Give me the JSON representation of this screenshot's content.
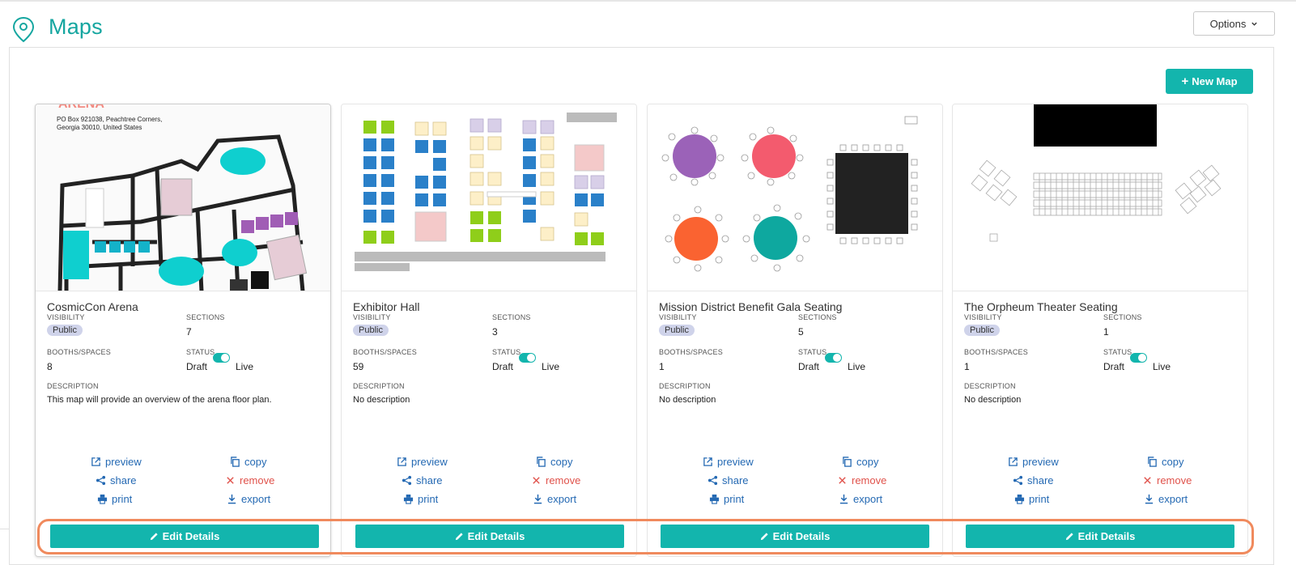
{
  "page": {
    "title": "Maps",
    "title_icon": "map-pin-icon",
    "options_label": "Options",
    "new_map_label": "New Map",
    "accent_color": "#13b5ad",
    "highlight_color": "#f08a5d"
  },
  "labels": {
    "visibility": "VISIBILITY",
    "sections": "SECTIONS",
    "booths": "BOOTHS/SPACES",
    "status": "STATUS",
    "description": "DESCRIPTION",
    "draft": "Draft",
    "live": "Live",
    "preview": "preview",
    "copy": "copy",
    "share": "share",
    "remove": "remove",
    "print": "print",
    "export": "export",
    "edit_details": "Edit Details"
  },
  "cards": [
    {
      "name": "CosmicCon Arena",
      "visibility": "Public",
      "sections": "7",
      "booths": "8",
      "status_live": true,
      "description": "This map will provide an overview of the arena floor plan.",
      "thumb_text": [
        "PO Box 921038, Peachtree Corners,",
        "Georgia 30010, United States"
      ],
      "thumb_heading": "ARENA"
    },
    {
      "name": "Exhibitor Hall",
      "visibility": "Public",
      "sections": "3",
      "booths": "59",
      "status_live": true,
      "description": "No description"
    },
    {
      "name": "Mission District Benefit Gala Seating",
      "visibility": "Public",
      "sections": "5",
      "booths": "1",
      "status_live": true,
      "description": "No description"
    },
    {
      "name": "The Orpheum Theater Seating",
      "visibility": "Public",
      "sections": "1",
      "booths": "1",
      "status_live": true,
      "description": "No description"
    }
  ]
}
